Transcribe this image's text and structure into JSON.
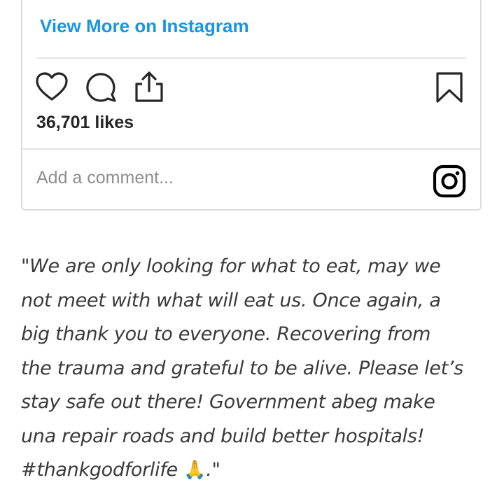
{
  "embed": {
    "view_more_label": "View More on Instagram",
    "likes_text": "36,701 likes",
    "comment_placeholder": "Add a comment...",
    "icons": {
      "like": "heart-icon",
      "comment": "comment-bubble-icon",
      "share": "share-upload-icon",
      "save": "bookmark-icon",
      "brand": "instagram-logo-icon"
    }
  },
  "article": {
    "quote_lines": [
      "\"We are only looking for what to eat, may we",
      "not meet with what will eat us. Once again, a",
      "big thank you to everyone. Recovering from",
      "the trauma and grateful to be alive. Please let’s",
      "stay safe out there! Government abeg make",
      "una repair roads and build better hospitals!",
      "#thankgodforlife"
    ],
    "quote_emoji": "🙏",
    "quote_end": ".\""
  },
  "colors": {
    "link": "#1a95e0",
    "border": "#dbdbdb",
    "text": "#262626",
    "placeholder": "#8e8e8e",
    "quote_text": "#3a3a3a"
  }
}
